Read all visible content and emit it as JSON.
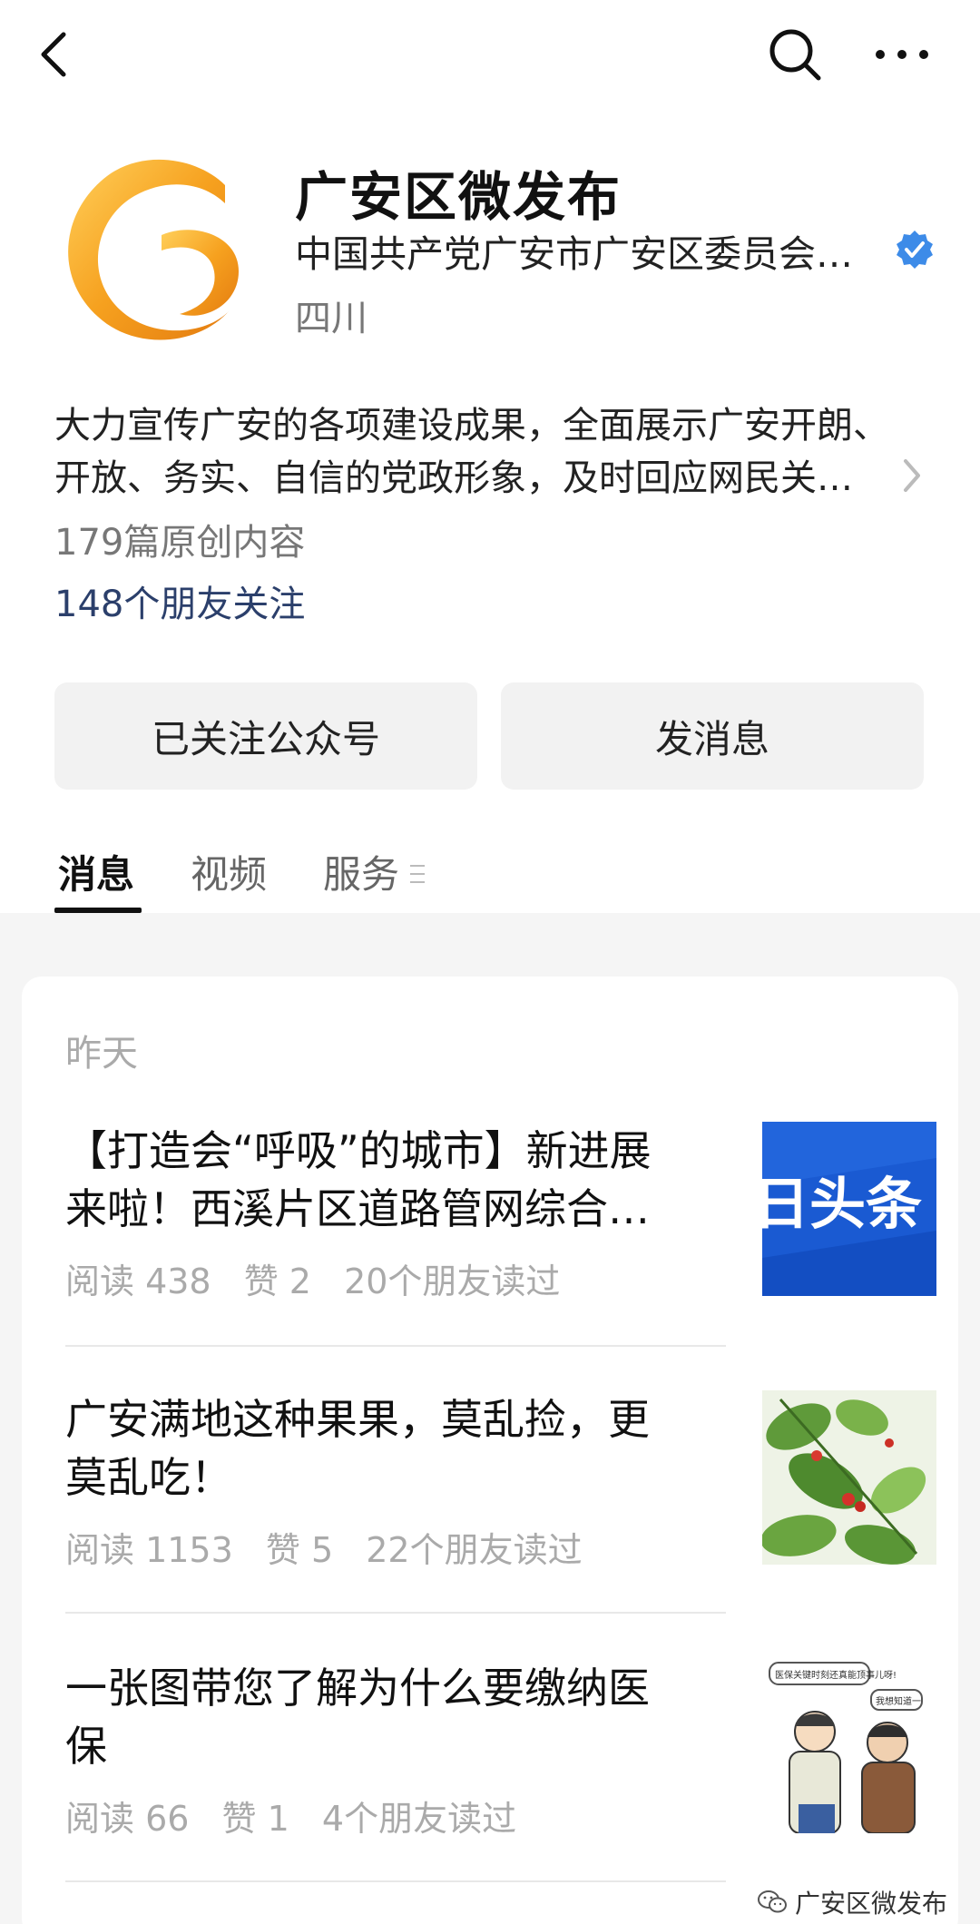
{
  "colors": {
    "link_blue": "#2b3f6b",
    "verified_blue": "#3d8be8",
    "logo_orange": "#f5a623"
  },
  "topbar": {
    "back_icon": "chevron-left-icon",
    "search_icon": "search-icon",
    "more_icon": "more-horizontal-icon"
  },
  "account": {
    "name": "广安区微发布",
    "org": "中国共产党广安市广安区委员会…",
    "region": "四川",
    "verified_icon": "verified-badge-icon",
    "description_line1": "大力宣传广安的各项建设成果，全面展示广安开朗、",
    "description_line2": "开放、务实、自信的党政形象，及时回应网民关…",
    "original_count": "179篇原创内容",
    "friends_following": "148个朋友关注"
  },
  "actions": {
    "follow_label": "已关注公众号",
    "message_label": "发消息"
  },
  "tabs": [
    {
      "label": "消息"
    },
    {
      "label": "视频"
    },
    {
      "label": "服务"
    }
  ],
  "feed": {
    "date_label": "昨天",
    "articles": [
      {
        "title_line1": "【打造会“呼吸”的城市】新进展",
        "title_line2": "来啦！西溪片区道路管网综合…",
        "reads": "阅读 438",
        "likes": "赞 2",
        "friends_read": "20个朋友读过",
        "thumb_text": "日头条"
      },
      {
        "title_line1": "广安满地这种果果，莫乱捡，更",
        "title_line2": "莫乱吃！",
        "reads": "阅读 1153",
        "likes": "赞 5",
        "friends_read": "22个朋友读过"
      },
      {
        "title_line1": "一张图带您了解为什么要缴纳医",
        "title_line2": "保",
        "reads": "阅读 66",
        "likes": "赞 1",
        "friends_read": "4个朋友读过",
        "bubble1": "医保关键时刻还真能顶事儿呀!",
        "bubble2": "我想知道一"
      }
    ]
  },
  "watermark": "广安区微发布"
}
